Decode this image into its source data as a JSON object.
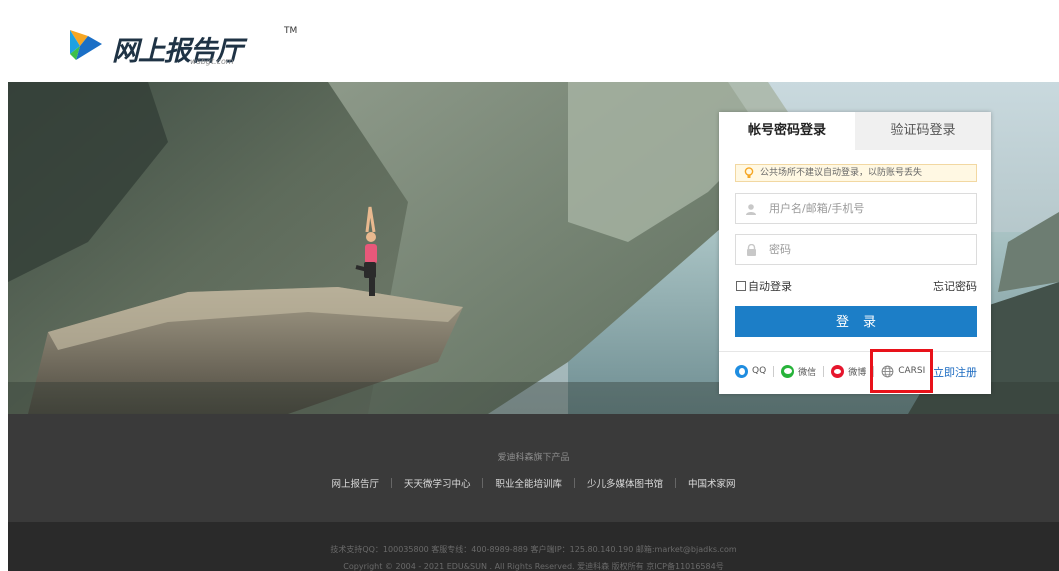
{
  "header": {
    "logo_text": "网上报告厅",
    "logo_tm": "TM",
    "logo_sub": "wsbgt.com"
  },
  "login": {
    "tabs": [
      {
        "label": "帐号密码登录",
        "active": true
      },
      {
        "label": "验证码登录",
        "active": false
      }
    ],
    "notice": "公共场所不建议自动登录，以防账号丢失",
    "username_placeholder": "用户名/邮箱/手机号",
    "password_placeholder": "密码",
    "remember_label": "自动登录",
    "forgot_label": "忘记密码",
    "login_button": "登录",
    "social": [
      {
        "label": "QQ",
        "icon": "qq-icon",
        "color": "#1f8de0"
      },
      {
        "label": "微信",
        "icon": "wechat-icon",
        "color": "#27b33a"
      },
      {
        "label": "微博",
        "icon": "weibo-icon",
        "color": "#e6162d"
      },
      {
        "label": "CARSI",
        "icon": "globe-icon",
        "color": "#888888"
      }
    ],
    "register_label": "立即注册"
  },
  "footer": {
    "made_by": "爱迪科森旗下产品",
    "links": [
      "网上报告厅",
      "天天微学习中心",
      "职业全能培训库",
      "少儿多媒体图书馆",
      "中国术家网"
    ],
    "support_line": "技术支持QQ：100035800  客服专线：400-8989-889  客户端IP：125.80.140.190  邮箱:market@bjadks.com",
    "copyright_line": "Copyright © 2004 - 2021 EDU&SUN . All Rights Reserved. 爱迪科森 版权所有 京ICP备11016584号"
  },
  "colors": {
    "primary_button": "#1c7ec7",
    "highlight_box": "#e8121a",
    "footer_bg": "#3a3a3a"
  }
}
